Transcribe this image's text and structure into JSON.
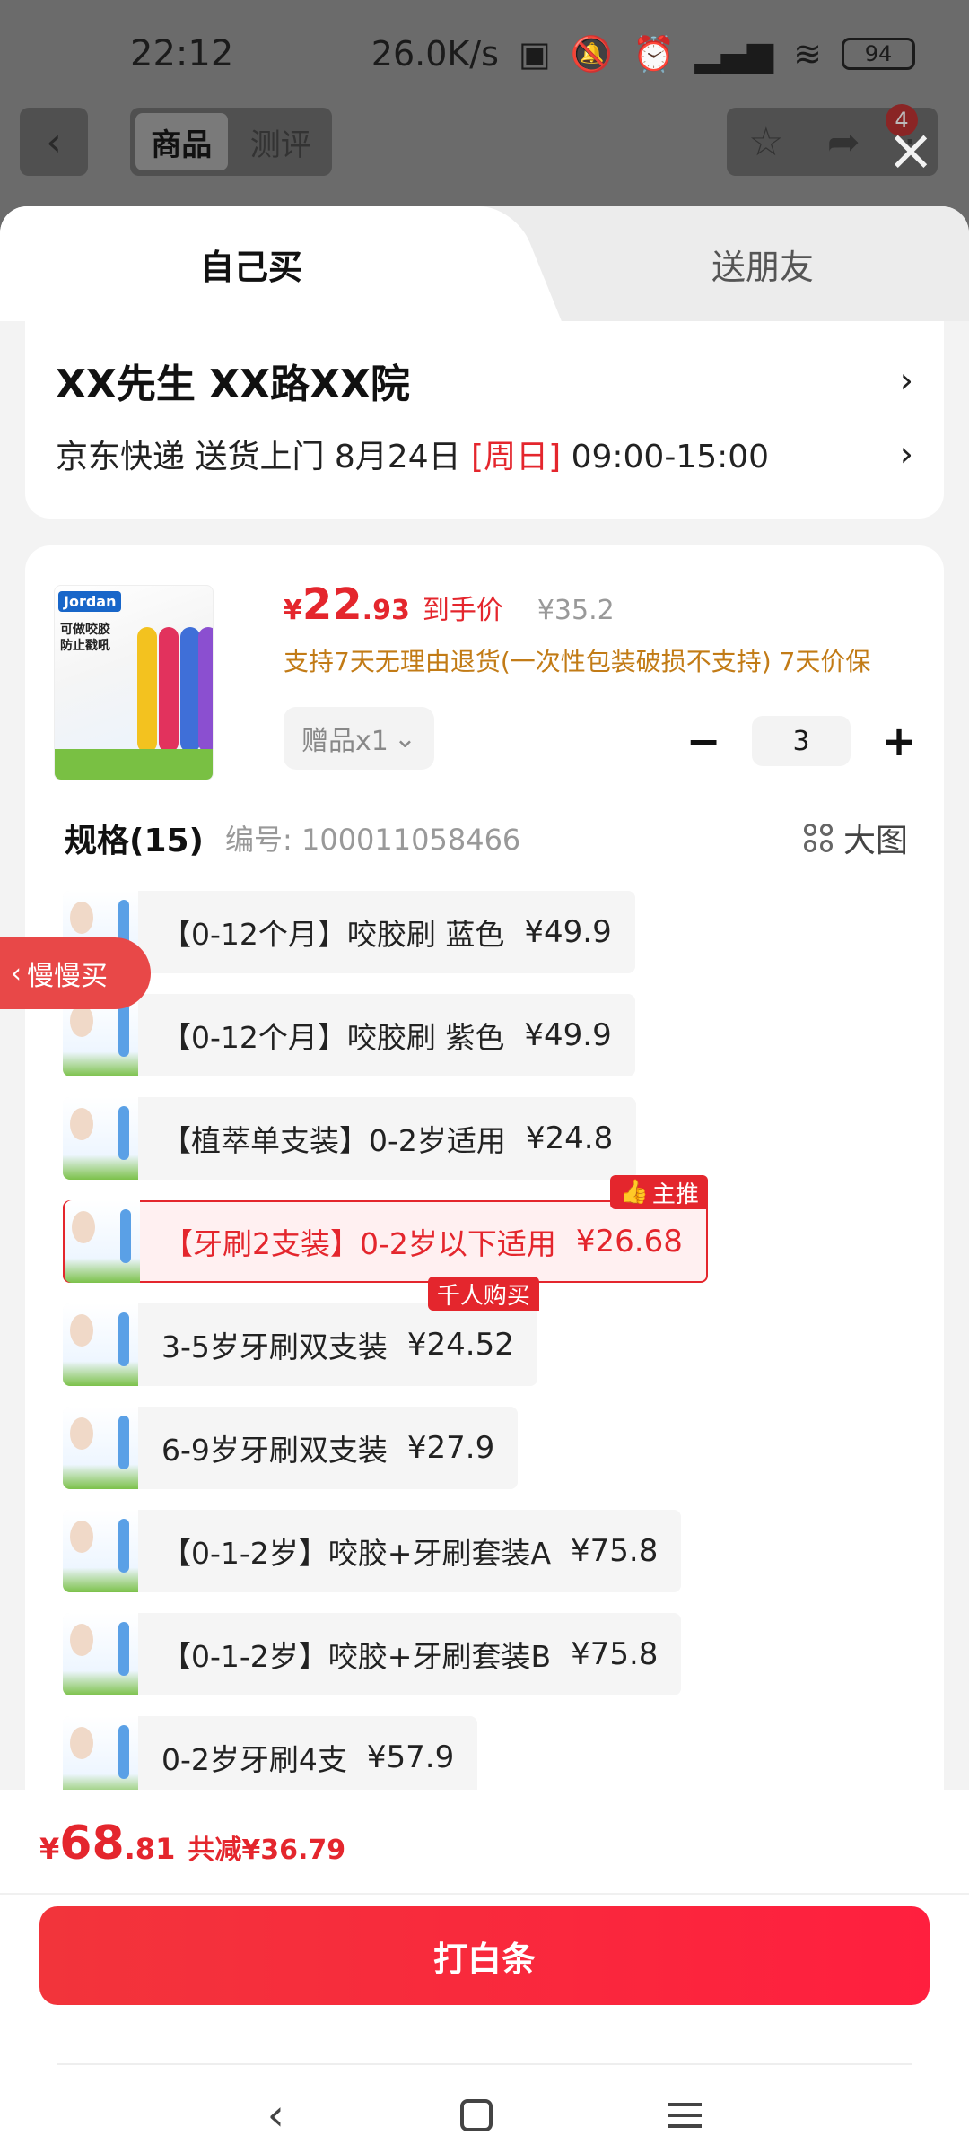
{
  "status": {
    "time": "22:12",
    "net_speed": "26.0K/s",
    "battery": "94"
  },
  "bg_nav": {
    "tab_product": "商品",
    "tab_review": "测评",
    "badge_count": "4"
  },
  "tabs": {
    "self_buy": "自己买",
    "send_friend": "送朋友"
  },
  "address": {
    "name": "XX先生  XX路XX院",
    "delivery_prefix": "京东快递 送货上门 8月24日 ",
    "delivery_day": "[周日]",
    "delivery_time": " 09:00-15:00"
  },
  "product": {
    "price_currency": "¥",
    "price_int": "22",
    "price_dec": ".93",
    "price_tag": "到手价",
    "orig_price": "¥35.2",
    "support": "支持7天无理由退货(一次性包装破损不支持) 7天价保",
    "gift": "赠品x1",
    "quantity": "3",
    "image_brand": "Jordan",
    "image_caption": "可做咬胶 防止戳吼"
  },
  "slow_buy": "慢慢买",
  "spec": {
    "title": "规格(15)",
    "code": "编号: 100011058466",
    "big_view": "大图",
    "items": [
      {
        "label": "【0-12个月】咬胶刷 蓝色",
        "price": "¥49.9",
        "badge": ""
      },
      {
        "label": "【0-12个月】咬胶刷 紫色",
        "price": "¥49.9",
        "badge": ""
      },
      {
        "label": "【植萃单支装】0-2岁适用",
        "price": "¥24.8",
        "badge": ""
      },
      {
        "label": "【牙刷2支装】0-2岁以下适用",
        "price": "¥26.68",
        "badge": "主推"
      },
      {
        "label": "3-5岁牙刷双支装",
        "price": "¥24.52",
        "badge": "千人购买"
      },
      {
        "label": "6-9岁牙刷双支装",
        "price": "¥27.9",
        "badge": ""
      },
      {
        "label": "【0-1-2岁】咬胶+牙刷套装A",
        "price": "¥75.8",
        "badge": ""
      },
      {
        "label": "【0-1-2岁】咬胶+牙刷套装B",
        "price": "¥75.8",
        "badge": ""
      },
      {
        "label": "0-2岁牙刷4支",
        "price": "¥57.9",
        "badge": ""
      }
    ]
  },
  "footer": {
    "total_currency": "¥",
    "total_int": "68",
    "total_dec": ".81",
    "savings": "共减¥36.79",
    "pay_button": "打白条"
  },
  "colors": {
    "accent_red": "#e4262d",
    "support_orange": "#c27b16"
  }
}
